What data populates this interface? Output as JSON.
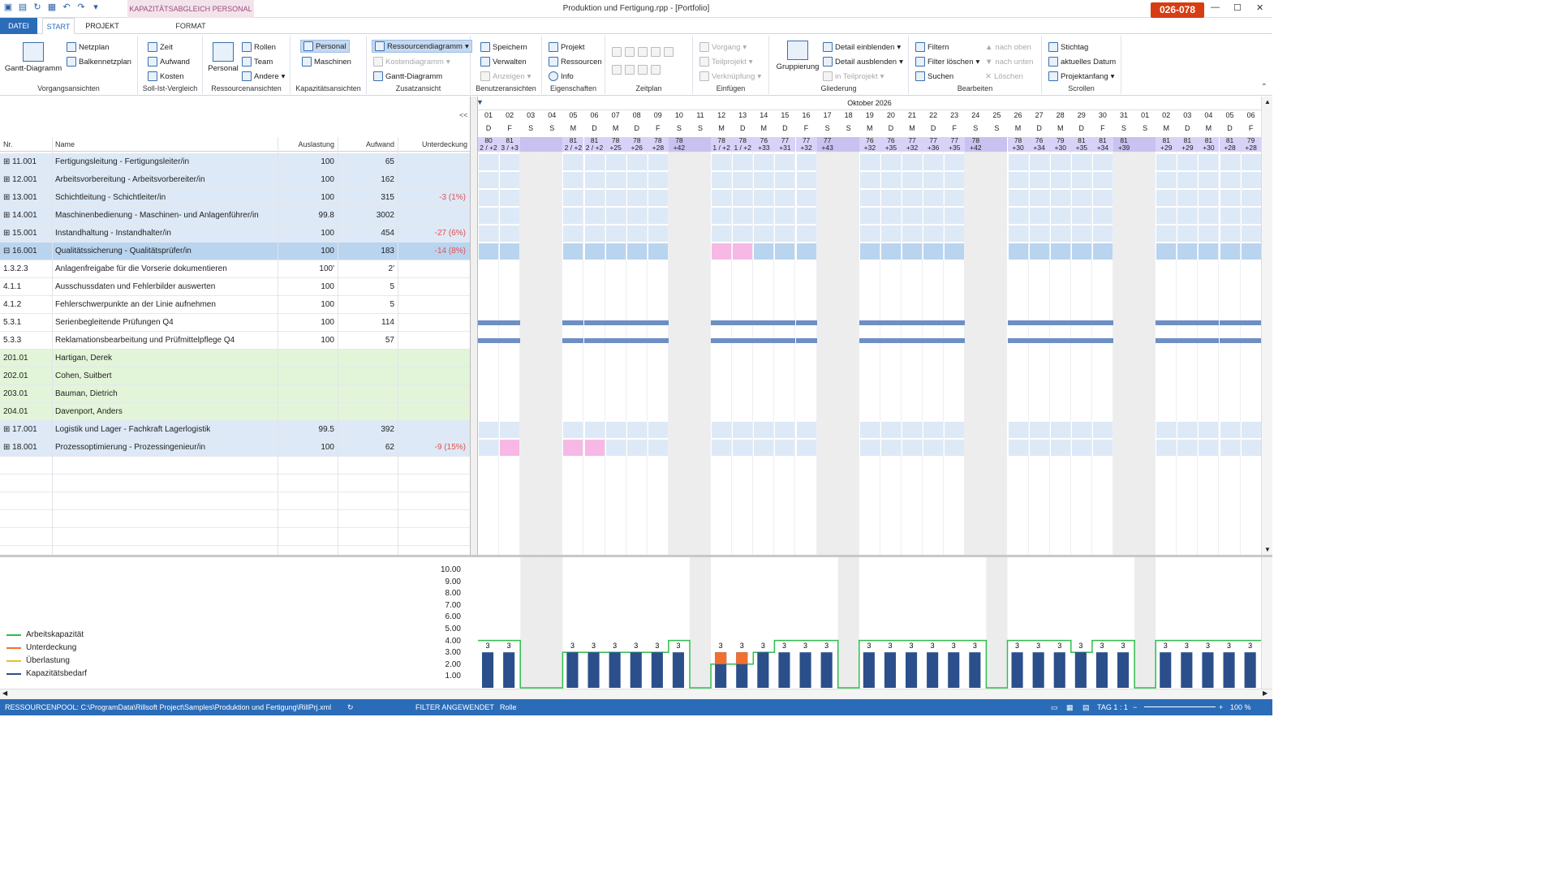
{
  "window": {
    "title": "Produktion und Fertigung.rpp - [Portfolio]",
    "context_tab": "KAPAZITÄTSABGLEICH PERSONAL",
    "badge": "026-078"
  },
  "tabs": [
    "DATEI",
    "START",
    "PROJEKT",
    "FORMAT"
  ],
  "ribbon": {
    "vorgang": {
      "label": "Vorgangsansichten",
      "gantt": "Gantt-Diagramm",
      "netzplan": "Netzplan",
      "balken": "Balkennetzplan"
    },
    "sollist": {
      "label": "Soll-Ist-Vergleich",
      "zeit": "Zeit",
      "aufwand": "Aufwand",
      "kosten": "Kosten"
    },
    "ressourcen": {
      "label": "Ressourcenansichten",
      "personal": "Personal",
      "rollen": "Rollen",
      "team": "Team",
      "andere": "Andere"
    },
    "kapazitaet": {
      "label": "Kapazitätsansichten",
      "personal": "Personal",
      "maschinen": "Maschinen"
    },
    "zusatz": {
      "label": "Zusatzansicht",
      "ressdia": "Ressourcendiagramm",
      "kosten": "Kostendiagramm",
      "gantt": "Gantt-Diagramm"
    },
    "benutzer": {
      "label": "Benutzeransichten",
      "speichern": "Speichern",
      "verwalten": "Verwalten",
      "anzeigen": "Anzeigen"
    },
    "eigen": {
      "label": "Eigenschaften",
      "projekt": "Projekt",
      "ressourcen": "Ressourcen",
      "info": "Info"
    },
    "zeitplan": {
      "label": "Zeitplan"
    },
    "einfuegen": {
      "label": "Einfügen",
      "vorgang": "Vorgang",
      "teilprojekt": "Teilprojekt",
      "verkn": "Verknüpfung"
    },
    "gliederung": {
      "label": "Gliederung",
      "gruppierung": "Gruppierung",
      "einblenden": "Detail einblenden",
      "ausblenden": "Detail ausblenden",
      "inteil": "in Teilprojekt"
    },
    "bearbeiten": {
      "label": "Bearbeiten",
      "filtern": "Filtern",
      "filterl": "Filter löschen",
      "suchen": "Suchen",
      "oben": "nach oben",
      "unten": "nach unten",
      "loeschen": "Löschen"
    },
    "scrollen": {
      "label": "Scrollen",
      "stichtag": "Stichtag",
      "aktuell": "aktuelles Datum",
      "anfang": "Projektanfang"
    }
  },
  "columns": {
    "nr": "Nr.",
    "name": "Name",
    "auslastung": "Auslastung",
    "aufwand": "Aufwand",
    "unterdeckung": "Unterdeckung"
  },
  "rows": [
    {
      "nr": "⊞ 11.001",
      "name": "Fertigungsleitung - Fertigungsleiter/in",
      "aus": "100",
      "auf": "65",
      "und": "",
      "type": "group"
    },
    {
      "nr": "⊞ 12.001",
      "name": "Arbeitsvorbereitung - Arbeitsvorbereiter/in",
      "aus": "100",
      "auf": "162",
      "und": "",
      "type": "group"
    },
    {
      "nr": "⊞ 13.001",
      "name": "Schichtleitung - Schichtleiter/in",
      "aus": "100",
      "auf": "315",
      "und": "-3 (1%)",
      "type": "group"
    },
    {
      "nr": "⊞ 14.001",
      "name": "Maschinenbedienung - Maschinen- und Anlagenführer/in",
      "aus": "99.8",
      "auf": "3002",
      "und": "",
      "type": "group"
    },
    {
      "nr": "⊞ 15.001",
      "name": "Instandhaltung - Instandhalter/in",
      "aus": "100",
      "auf": "454",
      "und": "-27 (6%)",
      "type": "group"
    },
    {
      "nr": "⊟ 16.001",
      "name": "Qualitätssicherung - Qualitätsprüfer/in",
      "aus": "100",
      "auf": "183",
      "und": "-14 (8%)",
      "type": "selected"
    },
    {
      "nr": "1.3.2.3",
      "name": "Anlagenfreigabe für die Vorserie dokumentieren",
      "aus": "100'",
      "auf": "2'",
      "und": "",
      "type": "task"
    },
    {
      "nr": "4.1.1",
      "name": "Ausschussdaten und Fehlerbilder auswerten",
      "aus": "100",
      "auf": "5",
      "und": "",
      "type": "task"
    },
    {
      "nr": "4.1.2",
      "name": "Fehlerschwerpunkte an der Linie aufnehmen",
      "aus": "100",
      "auf": "5",
      "und": "",
      "type": "task"
    },
    {
      "nr": "5.3.1",
      "name": "Serienbegleitende Prüfungen Q4",
      "aus": "100",
      "auf": "114",
      "und": "",
      "type": "task"
    },
    {
      "nr": "5.3.3",
      "name": "Reklamationsbearbeitung und Prüfmittelpflege Q4",
      "aus": "100",
      "auf": "57",
      "und": "",
      "type": "task"
    },
    {
      "nr": "201.01",
      "name": "Hartigan, Derek",
      "aus": "",
      "auf": "",
      "und": "",
      "type": "person"
    },
    {
      "nr": "202.01",
      "name": "Cohen, Suitbert",
      "aus": "",
      "auf": "",
      "und": "",
      "type": "person"
    },
    {
      "nr": "203.01",
      "name": "Bauman, Dietrich",
      "aus": "",
      "auf": "",
      "und": "",
      "type": "person"
    },
    {
      "nr": "204.01",
      "name": "Davenport, Anders",
      "aus": "",
      "auf": "",
      "und": "",
      "type": "person"
    },
    {
      "nr": "⊞ 17.001",
      "name": "Logistik und Lager - Fachkraft Lagerlogistik",
      "aus": "99.5",
      "auf": "392",
      "und": "",
      "type": "group"
    },
    {
      "nr": "⊞ 18.001",
      "name": "Prozessoptimierung - Prozessingenieur/in",
      "aus": "100",
      "auf": "62",
      "und": "-9 (15%)",
      "type": "group"
    }
  ],
  "timeline": {
    "month": "Oktober 2026",
    "days": [
      "01",
      "02",
      "03",
      "04",
      "05",
      "06",
      "07",
      "08",
      "09",
      "10",
      "11",
      "12",
      "13",
      "14",
      "15",
      "16",
      "17",
      "18",
      "19",
      "20",
      "21",
      "22",
      "23",
      "24",
      "25",
      "26",
      "27",
      "28",
      "29",
      "30",
      "31",
      "01",
      "02",
      "03",
      "04",
      "05",
      "06"
    ],
    "letters": [
      "D",
      "F",
      "S",
      "S",
      "M",
      "D",
      "M",
      "D",
      "F",
      "S",
      "S",
      "M",
      "D",
      "M",
      "D",
      "F",
      "S",
      "S",
      "M",
      "D",
      "M",
      "D",
      "F",
      "S",
      "S",
      "M",
      "D",
      "M",
      "D",
      "F",
      "S",
      "S",
      "M",
      "D",
      "M",
      "D",
      "F"
    ],
    "summary_top": [
      "80",
      "81",
      "",
      "",
      "81",
      "81",
      "78",
      "78",
      "78",
      "78",
      "",
      "78",
      "78",
      "76",
      "77",
      "77",
      "77",
      "",
      "76",
      "76",
      "77",
      "77",
      "77",
      "78",
      "",
      "78",
      "76",
      "79",
      "81",
      "81",
      "81",
      "",
      "81",
      "81",
      "81",
      "81",
      "79"
    ],
    "summary_bot": [
      "2 / +2",
      "3 / +3",
      "",
      "",
      "2 / +2",
      "2 / +2",
      "+25",
      "+26",
      "+28",
      "+42",
      "",
      "1 / +2",
      "1 / +2",
      "+33",
      "+31",
      "+32",
      "+43",
      "",
      "+32",
      "+35",
      "+32",
      "+36",
      "+35",
      "+42",
      "",
      "+30",
      "+34",
      "+30",
      "+35",
      "+34",
      "+39",
      "",
      "+29",
      "+29",
      "+30",
      "+28",
      "+28"
    ]
  },
  "chart": {
    "legend": [
      "Arbeitskapazität",
      "Unterdeckung",
      "Überlastung",
      "Kapazitätsbedarf"
    ],
    "legend_colors": [
      "#2ebd4e",
      "#f07030",
      "#e8c020",
      "#2b4f8a"
    ],
    "yticks": [
      "10.00",
      "9.00",
      "8.00",
      "7.00",
      "6.00",
      "5.00",
      "4.00",
      "3.00",
      "2.00",
      "1.00"
    ]
  },
  "chart_data": {
    "type": "bar",
    "ylim": [
      0,
      10.5
    ],
    "categories": [
      "01",
      "02",
      "03",
      "04",
      "05",
      "06",
      "07",
      "08",
      "09",
      "10",
      "11",
      "12",
      "13",
      "14",
      "15",
      "16",
      "17",
      "18",
      "19",
      "20",
      "21",
      "22",
      "23",
      "24",
      "25",
      "26",
      "27",
      "28",
      "29",
      "30",
      "31",
      "01",
      "02",
      "03",
      "04",
      "05",
      "06"
    ],
    "bar_labels": [
      "3",
      "3",
      "",
      "",
      "3",
      "3",
      "3",
      "3",
      "3",
      "3",
      "",
      "3",
      "3",
      "3",
      "3",
      "3",
      "3",
      "",
      "3",
      "3",
      "3",
      "3",
      "3",
      "3",
      "",
      "3",
      "3",
      "3",
      "3",
      "3",
      "3",
      "",
      "3",
      "3",
      "3",
      "3",
      "3"
    ],
    "series": [
      {
        "name": "Kapazitätsbedarf",
        "values": [
          3,
          3,
          0,
          0,
          3,
          3,
          3,
          3,
          3,
          3,
          0,
          3,
          3,
          3,
          3,
          3,
          3,
          0,
          3,
          3,
          3,
          3,
          3,
          3,
          0,
          3,
          3,
          3,
          3,
          3,
          3,
          0,
          3,
          3,
          3,
          3,
          3
        ]
      },
      {
        "name": "Arbeitskapazität",
        "values": [
          4,
          4,
          0,
          0,
          3,
          3,
          3,
          3,
          3,
          4,
          0,
          2,
          2,
          3,
          4,
          4,
          4,
          0,
          4,
          4,
          4,
          4,
          4,
          4,
          0,
          4,
          4,
          4,
          3,
          4,
          4,
          0,
          4,
          4,
          4,
          4,
          4
        ]
      },
      {
        "name": "Unterdeckung",
        "values": [
          0,
          0,
          0,
          0,
          0,
          0,
          0,
          0,
          0,
          0,
          0,
          1,
          1,
          0,
          0,
          0,
          0,
          0,
          0,
          0,
          0,
          0,
          0,
          0,
          0,
          0,
          0,
          0,
          0,
          0,
          0,
          0,
          0,
          0,
          0,
          0,
          0
        ]
      }
    ]
  },
  "status": {
    "pool": "RESSOURCENPOOL: C:\\ProgramData\\Rillsoft Project\\Samples\\Produktion und Fertigung\\RillPrj.xml",
    "filter": "FILTER ANGEWENDET",
    "rolle": "Rolle",
    "tag": "TAG 1 : 1",
    "zoom": "100 %"
  }
}
